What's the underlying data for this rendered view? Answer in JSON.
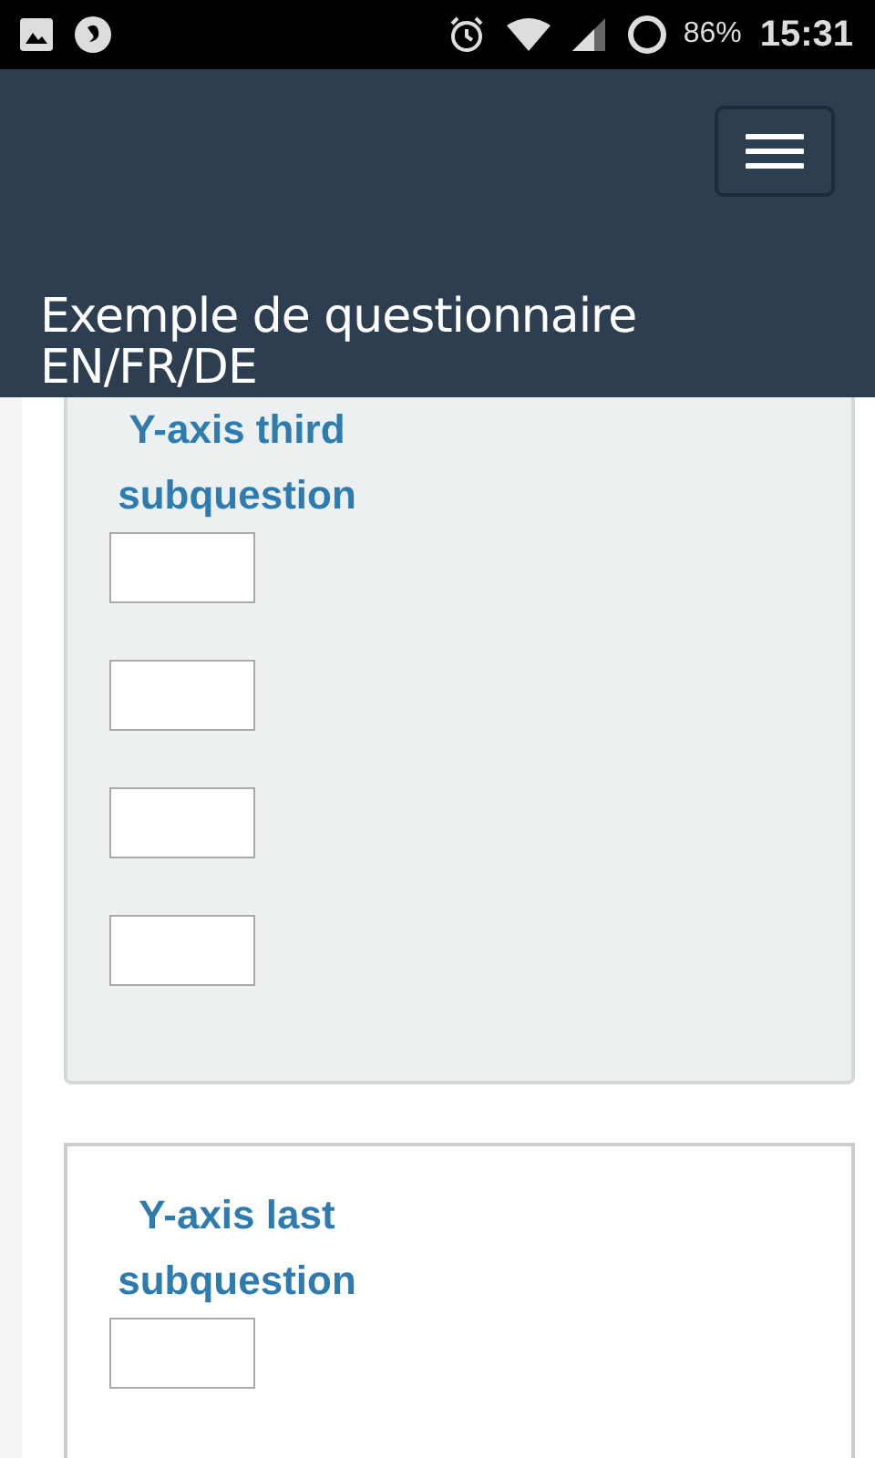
{
  "status_bar": {
    "battery": "86%",
    "time": "15:31"
  },
  "header": {
    "title": "Exemple de questionnaire EN/FR/DE"
  },
  "questions": [
    {
      "kind": "shaded",
      "label": "Y-axis third subquestion",
      "fields": [
        {
          "kind": "text"
        },
        {
          "kind": "text"
        },
        {
          "kind": "text"
        },
        {
          "kind": "text"
        }
      ]
    },
    {
      "kind": "bordered",
      "label": "Y-axis last subquestion",
      "fields": [
        {
          "kind": "text"
        }
      ]
    }
  ]
}
